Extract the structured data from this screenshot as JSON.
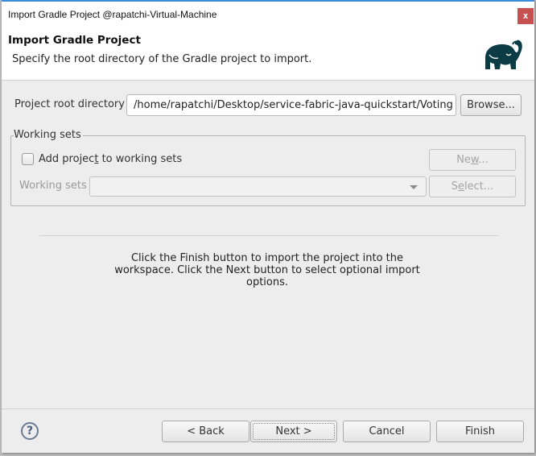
{
  "window": {
    "title": "Import Gradle Project @rapatchi-Virtual-Machine",
    "close_label": "x",
    "accent_color": "#3c8dde",
    "close_color": "#c75050"
  },
  "banner": {
    "heading": "Import Gradle Project",
    "description": "Specify the root directory of the Gradle project to import.",
    "logo_icon": "gradle-elephant-icon"
  },
  "form": {
    "root_label": "Project root directory",
    "root_value": "/home/rapatchi/Desktop/service-fabric-java-quickstart/Voting",
    "browse_label": "Browse..."
  },
  "working_sets": {
    "group_label": "Working sets",
    "checkbox": {
      "pre": "Add projec",
      "mnemonic": "t",
      "post": " to working sets",
      "checked": false
    },
    "field_label": "Working sets",
    "combo_value": "",
    "new_button": {
      "pre": "Ne",
      "mnemonic": "w",
      "post": "..."
    },
    "select_button": {
      "pre": "S",
      "mnemonic": "e",
      "post": "lect..."
    }
  },
  "info_text": "Click the Finish button to import the project into the workspace. Click the Next button to select optional import options.",
  "footer": {
    "help_icon": "?",
    "back_label": "< Back",
    "next_label": "Next >",
    "cancel_label": "Cancel",
    "finish_label": "Finish"
  }
}
